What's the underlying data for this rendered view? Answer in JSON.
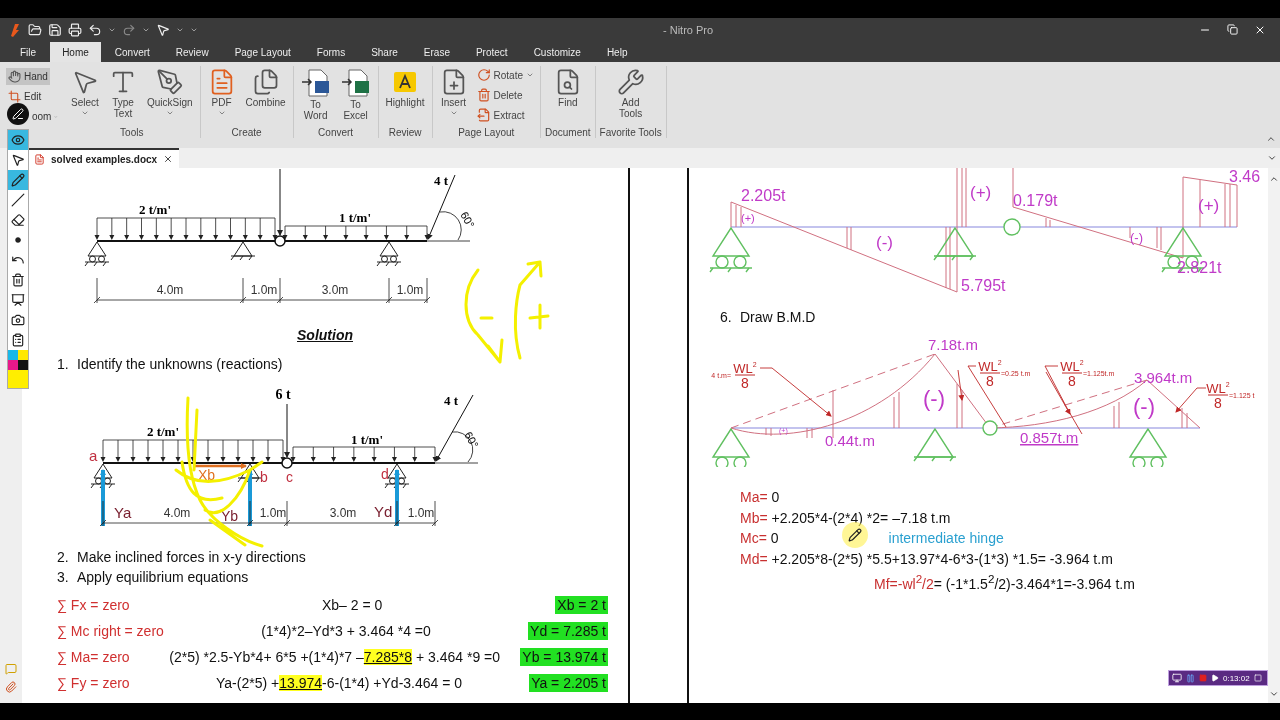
{
  "title_bar": {
    "title": "- Nitro Pro"
  },
  "menu_tabs": [
    {
      "label": "File",
      "selected": false
    },
    {
      "label": "Home",
      "selected": true
    },
    {
      "label": "Convert",
      "selected": false
    },
    {
      "label": "Review",
      "selected": false
    },
    {
      "label": "Page Layout",
      "selected": false
    },
    {
      "label": "Forms",
      "selected": false
    },
    {
      "label": "Share",
      "selected": false
    },
    {
      "label": "Erase",
      "selected": false
    },
    {
      "label": "Protect",
      "selected": false
    },
    {
      "label": "Customize",
      "selected": false
    },
    {
      "label": "Help",
      "selected": false
    }
  ],
  "ribbon": {
    "modes": [
      {
        "label": "Hand",
        "selected": true,
        "dropdown": false
      },
      {
        "label": "Edit",
        "selected": false,
        "dropdown": false
      },
      {
        "label": "oom",
        "selected": false,
        "dropdown": true
      }
    ],
    "groups": [
      {
        "title": "Tools",
        "buttons": [
          {
            "label": "Select",
            "kind": "large",
            "dropdown": true
          },
          {
            "label": "Type Text",
            "kind": "large",
            "dropdown": false
          },
          {
            "label": "QuickSign",
            "kind": "large",
            "dropdown": true
          }
        ]
      },
      {
        "title": "Create",
        "buttons": [
          {
            "label": "PDF",
            "kind": "large",
            "dropdown": true
          },
          {
            "label": "Combine",
            "kind": "large",
            "dropdown": false
          }
        ]
      },
      {
        "title": "Convert",
        "buttons": [
          {
            "label": "To Word",
            "kind": "large",
            "dropdown": false
          },
          {
            "label": "To Excel",
            "kind": "large",
            "dropdown": false
          }
        ]
      },
      {
        "title": "Review",
        "buttons": [
          {
            "label": "Highlight",
            "kind": "large",
            "dropdown": false
          }
        ]
      },
      {
        "title": "Page Layout",
        "buttons": [
          {
            "label": "Insert",
            "kind": "large",
            "dropdown": true
          },
          {
            "label": "Rotate",
            "kind": "small",
            "dropdown": true
          },
          {
            "label": "Delete",
            "kind": "small",
            "dropdown": false
          },
          {
            "label": "Extract",
            "kind": "small",
            "dropdown": false
          }
        ]
      },
      {
        "title": "Document",
        "buttons": [
          {
            "label": "Find",
            "kind": "large",
            "dropdown": false
          }
        ]
      },
      {
        "title": "Favorite Tools",
        "buttons": [
          {
            "label": "Add Tools",
            "kind": "large",
            "dropdown": false
          }
        ]
      }
    ]
  },
  "annotation_tools": [
    {
      "selected": true
    },
    {
      "selected": false
    },
    {
      "selected": true
    },
    {
      "selected": false
    },
    {
      "selected": false
    },
    {
      "selected": false
    },
    {
      "selected": false
    },
    {
      "selected": false
    },
    {
      "selected": false
    },
    {
      "selected": false
    },
    {
      "selected": false
    }
  ],
  "document_tab": {
    "label": "solved examples.docx"
  },
  "left_page": {
    "problem_beam": {
      "distributed_loads": [
        "2 t/m'",
        "1 t/m'"
      ],
      "inclined_load": "4 t",
      "angle": "60°",
      "spans": [
        "4.0m",
        "1.0m",
        "3.0m",
        "1.0m"
      ]
    },
    "solution_heading": "Solution",
    "step_1": {
      "number": "1.",
      "text": "Identify the unknowns (reactions)"
    },
    "reaction_beam": {
      "distributed_loads": [
        "2 t/m'",
        "1 t/m'"
      ],
      "point_load": "6 t",
      "inclined_load": "4 t",
      "angle": "60°",
      "nodes": [
        "a",
        "b",
        "c",
        "d"
      ],
      "horizontal_reaction": "Xb",
      "reactions": [
        "Ya",
        "Yb",
        "Yd"
      ],
      "spans": [
        "4.0m",
        "1.0m",
        "3.0m",
        "1.0m"
      ]
    },
    "steps": [
      {
        "number": "2.",
        "text": "Make inclined forces in x-y directions"
      },
      {
        "number": "3.",
        "text": "Apply equilibrium equations"
      }
    ],
    "equations": [
      {
        "label": "∑ Fx = zero",
        "parts": [
          {
            "text": "Xb– 2 = 0",
            "highlighted": false
          }
        ],
        "result": "Xb = 2 t"
      },
      {
        "label": "∑ Mc right = zero",
        "parts": [
          {
            "text": "(1*4)*2–Yd*3 + 3.464 *4 =0",
            "highlighted": false
          }
        ],
        "result": "Yd = 7.285 t"
      },
      {
        "label": "∑ Ma= zero",
        "parts": [
          {
            "text": "(2*5) *2.5-Yb*4+ 6*5 +(1*4)*7 –",
            "highlighted": false
          },
          {
            "text": "7.285*8",
            "highlighted": true
          },
          {
            "text": " + 3.464 *9 =0",
            "highlighted": false
          }
        ],
        "result": "Yb = 13.974 t"
      },
      {
        "label": "∑ Fy = zero",
        "parts": [
          {
            "text": "Ya-(2*5) +",
            "highlighted": false
          },
          {
            "text": "13.974",
            "highlighted": true
          },
          {
            "text": "-6-(1*4) +Yd-3.464 = 0",
            "highlighted": false
          }
        ],
        "result": "Ya = 2.205 t"
      }
    ]
  },
  "right_page": {
    "sfd": {
      "values": [
        "2.205t",
        "5.795t",
        "0.179t",
        "2.821t",
        "3.46"
      ],
      "signs": [
        "(+)",
        "(-)",
        "(+)",
        "(-)",
        "(+)"
      ]
    },
    "step_6": {
      "number": "6.",
      "text": "Draw B.M.D"
    },
    "bmd": {
      "values": [
        "7.18t.m",
        "0.44t.m",
        "0.857t.m",
        "3.964t.m"
      ],
      "signs": [
        "(+)",
        "(-)",
        "(-)"
      ],
      "notes": [
        {
          "prefix": "4 t.m=",
          "numerator": "WL",
          "exponent": "2",
          "denominator": "8"
        },
        {
          "numerator": "WL",
          "exponent": "2",
          "denominator": "8",
          "suffix": "=0.25 t.m"
        },
        {
          "numerator": "WL",
          "exponent": "2",
          "denominator": "8",
          "suffix": "=1.125t.m"
        },
        {
          "numerator": "WL",
          "exponent": "2",
          "denominator": "8",
          "suffix": "=1.125 t"
        }
      ]
    },
    "moments": [
      {
        "label": "Ma=",
        "expression": "0"
      },
      {
        "label": "Mb=",
        "expression": "+2.205*4-(2*4) *2= –7.18 t.m"
      },
      {
        "label": "Mc=",
        "expression": "0",
        "note": "intermediate hinge"
      },
      {
        "label": "Md=",
        "expression": "+2.205*8-(2*5) *5.5+13.97*4-6*3-(1*3) *1.5= -3.964 t.m"
      }
    ],
    "free_end_moment": {
      "label": "Mf=-wl$^{2}$/2",
      "expression": "= (-1*1.5$^{2}$/2)-3.464*1=-3.964 t.m"
    }
  },
  "recorder": {
    "time": "0:13:02"
  }
}
